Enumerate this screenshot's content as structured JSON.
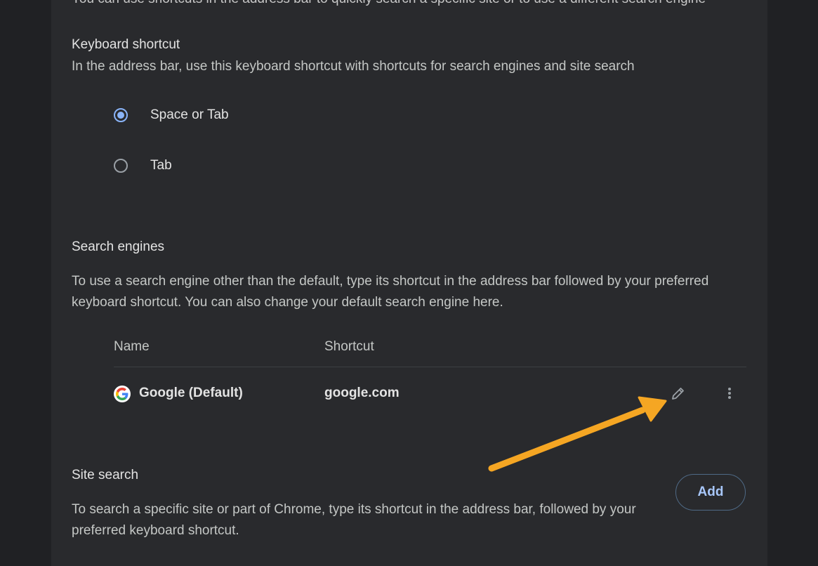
{
  "header": {
    "clipped_text": "You can use shortcuts in the address bar to quickly search a specific site or to use a different search engine"
  },
  "keyboard_shortcut": {
    "title": "Keyboard shortcut",
    "description": "In the address bar, use this keyboard shortcut with shortcuts for search engines and site search",
    "options": [
      {
        "label": "Space or Tab",
        "checked": true
      },
      {
        "label": "Tab",
        "checked": false
      }
    ]
  },
  "search_engines": {
    "title": "Search engines",
    "description": "To use a search engine other than the default, type its shortcut in the address bar followed by your preferred keyboard shortcut. You can also change your default search engine here.",
    "columns": {
      "name": "Name",
      "shortcut": "Shortcut"
    },
    "rows": [
      {
        "name": "Google (Default)",
        "shortcut": "google.com",
        "icon": "google-logo-icon"
      }
    ],
    "edit_icon": "pencil-icon",
    "more_icon": "more-vert-icon"
  },
  "site_search": {
    "title": "Site search",
    "description": "To search a specific site or part of Chrome, type its shortcut in the address bar, followed by your preferred keyboard shortcut.",
    "add_label": "Add"
  },
  "annotation": {
    "arrow_color": "#f5a623",
    "arrow_icon": "annotation-arrow-icon"
  },
  "colors": {
    "background": "#202124",
    "card": "#292a2d",
    "accent": "#8ab4f8",
    "button_text": "#a8c7fa"
  }
}
